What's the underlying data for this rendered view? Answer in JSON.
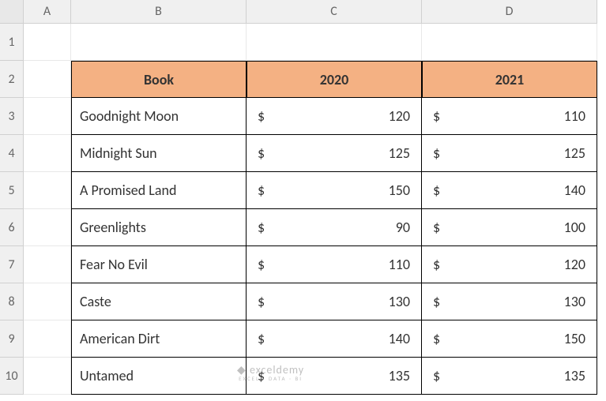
{
  "columns": [
    "A",
    "B",
    "C",
    "D"
  ],
  "row_numbers": [
    "1",
    "2",
    "3",
    "4",
    "5",
    "6",
    "7",
    "8",
    "9",
    "10"
  ],
  "headers": {
    "book": "Book",
    "year1": "2020",
    "year2": "2021"
  },
  "currency": "$",
  "rows": [
    {
      "book": "Goodnight Moon",
      "y1": "120",
      "y2": "110"
    },
    {
      "book": "Midnight Sun",
      "y1": "125",
      "y2": "125"
    },
    {
      "book": "A Promised Land",
      "y1": "150",
      "y2": "140"
    },
    {
      "book": "Greenlights",
      "y1": "90",
      "y2": "100"
    },
    {
      "book": "Fear No Evil",
      "y1": "110",
      "y2": "120"
    },
    {
      "book": "Caste",
      "y1": "130",
      "y2": "130"
    },
    {
      "book": "American Dirt",
      "y1": "140",
      "y2": "150"
    },
    {
      "book": "Untamed",
      "y1": "135",
      "y2": "135"
    }
  ],
  "watermark": {
    "main": "exceldemy",
    "sub": "EXCEL · DATA · BI"
  }
}
